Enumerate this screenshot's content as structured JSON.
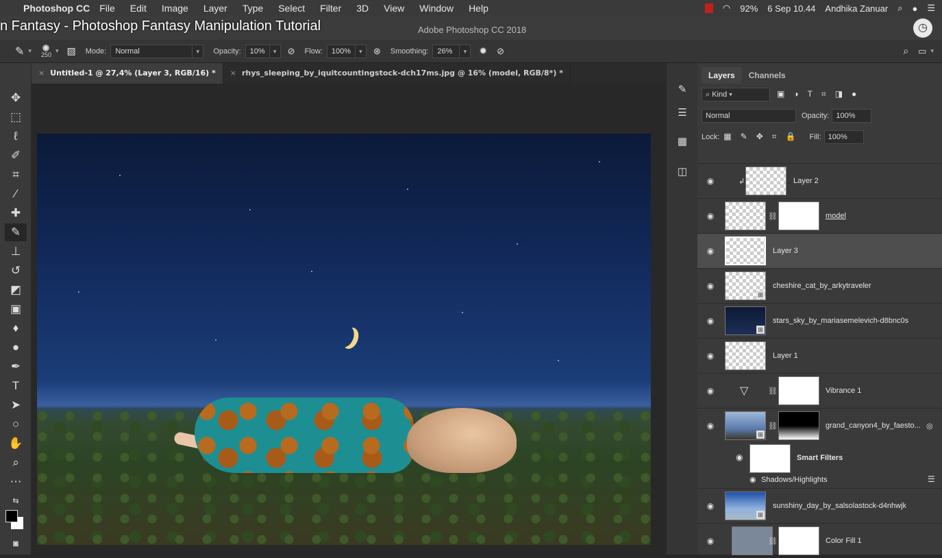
{
  "menubar": {
    "apple": "",
    "app_name": "Photoshop CC",
    "items": [
      "File",
      "Edit",
      "Image",
      "Layer",
      "Type",
      "Select",
      "Filter",
      "3D",
      "View",
      "Window",
      "Help"
    ],
    "battery": "92%",
    "datetime": "6 Sep 10.44",
    "user": "Andhika Zanuar"
  },
  "titlebar": {
    "video_title": "n Fantasy - Photoshop Fantasy Manipulation Tutorial",
    "window_title": "Adobe Photoshop CC 2018"
  },
  "options": {
    "brush_size": "250",
    "mode_label": "Mode:",
    "mode_value": "Normal",
    "opacity_label": "Opacity:",
    "opacity_value": "10%",
    "flow_label": "Flow:",
    "flow_value": "100%",
    "smoothing_label": "Smoothing:",
    "smoothing_value": "26%"
  },
  "tabs": [
    {
      "label": "Untitled-1 @ 27,4% (Layer 3, RGB/16) *"
    },
    {
      "label": "rhys_sleeping_by_iquitcountingstock-dch17ms.jpg @ 16% (model, RGB/8*) *"
    }
  ],
  "panel": {
    "tabs": [
      "Layers",
      "Channels"
    ],
    "filter_kind": "Kind",
    "blend_mode": "Normal",
    "opacity_label": "Opacity:",
    "opacity_value": "100%",
    "lock_label": "Lock:",
    "fill_label": "Fill:",
    "fill_value": "100%"
  },
  "layers": [
    {
      "name": "Layer 2"
    },
    {
      "name": "model"
    },
    {
      "name": "Layer 3"
    },
    {
      "name": "cheshire_cat_by_arkytraveler"
    },
    {
      "name": "stars_sky_by_mariasemelevich-d8bnc0s"
    },
    {
      "name": "Layer 1"
    },
    {
      "name": "Vibrance 1"
    },
    {
      "name": "grand_canyon4_by_faesto..."
    },
    {
      "name": "Smart Filters"
    },
    {
      "name": "Shadows/Highlights"
    },
    {
      "name": "sunshiny_day_by_salsolastock-d4nhwjk"
    },
    {
      "name": "Color Fill 1"
    }
  ]
}
